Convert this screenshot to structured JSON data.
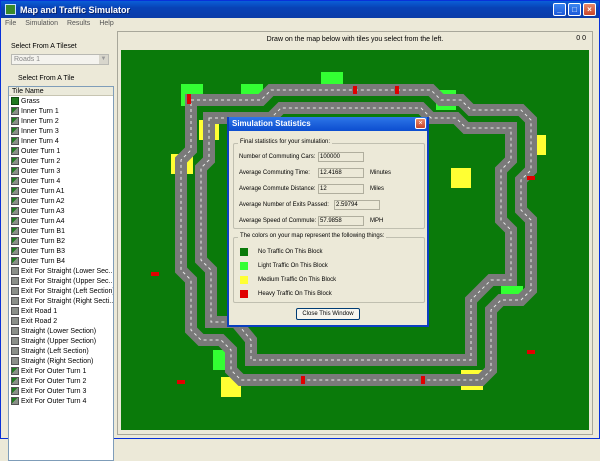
{
  "window": {
    "title": "Map and Traffic Simulator",
    "minimize": "_",
    "maximize": "□",
    "close": "×"
  },
  "menu": [
    "File",
    "Simulation",
    "Results",
    "Help"
  ],
  "left": {
    "tileset_label": "Select From A Tileset",
    "tileset_value": "Roads 1",
    "tile_label": "Select From A Tile",
    "list_header": "Tile Name",
    "tiles": [
      "Grass",
      "Inner Turn 1",
      "Inner Turn 2",
      "Inner Turn 3",
      "Inner Turn 4",
      "Outer Turn 1",
      "Outer Turn 2",
      "Outer Turn 3",
      "Outer Turn 4",
      "Outer Turn A1",
      "Outer Turn A2",
      "Outer Turn A3",
      "Outer Turn A4",
      "Outer Turn B1",
      "Outer Turn B2",
      "Outer Turn B3",
      "Outer Turn B4",
      "Exit For Straight (Lower Sec...",
      "Exit For Straight (Upper Sec...",
      "Exit For Straight (Left Section)",
      "Exit For Straight (Right Secti...",
      "Exit Road 1",
      "Exit Road 2",
      "Straight (Lower Section)",
      "Straight (Upper Section)",
      "Straight (Left Section)",
      "Straight (Right Section)",
      "Exit For Outer Turn 1",
      "Exit For Outer Turn 2",
      "Exit For Outer Turn 3",
      "Exit For Outer Turn 4"
    ]
  },
  "map": {
    "instruction": "Draw on the map below with tiles you select from the left.",
    "coords": "0  0"
  },
  "dialog": {
    "title": "Simulation Statistics",
    "close": "×",
    "stats_caption": "Final statistics for your simulation:",
    "stats": [
      {
        "label": "Number of Commuting Cars:",
        "value": "100000",
        "unit": ""
      },
      {
        "label": "Average Commuting Time:",
        "value": "12.4168",
        "unit": "Minutes"
      },
      {
        "label": "Average Commute Distance:",
        "value": "12",
        "unit": "Miles"
      },
      {
        "label": "Average Number of Exits Passed:",
        "value": "2.59794",
        "unit": ""
      },
      {
        "label": "Average Speed of Commute:",
        "value": "57.9858",
        "unit": "MPH"
      }
    ],
    "legend_caption": "The colors on your map represent the following things:",
    "legend": [
      {
        "color": "#0a7a0a",
        "text": "No Traffic On This Block"
      },
      {
        "color": "#33ff33",
        "text": "Light Traffic On This Block"
      },
      {
        "color": "#ffff33",
        "text": "Medium Traffic On This Block"
      },
      {
        "color": "#e00000",
        "text": "Heavy Traffic On This Block"
      }
    ],
    "button": "Close This Window"
  }
}
